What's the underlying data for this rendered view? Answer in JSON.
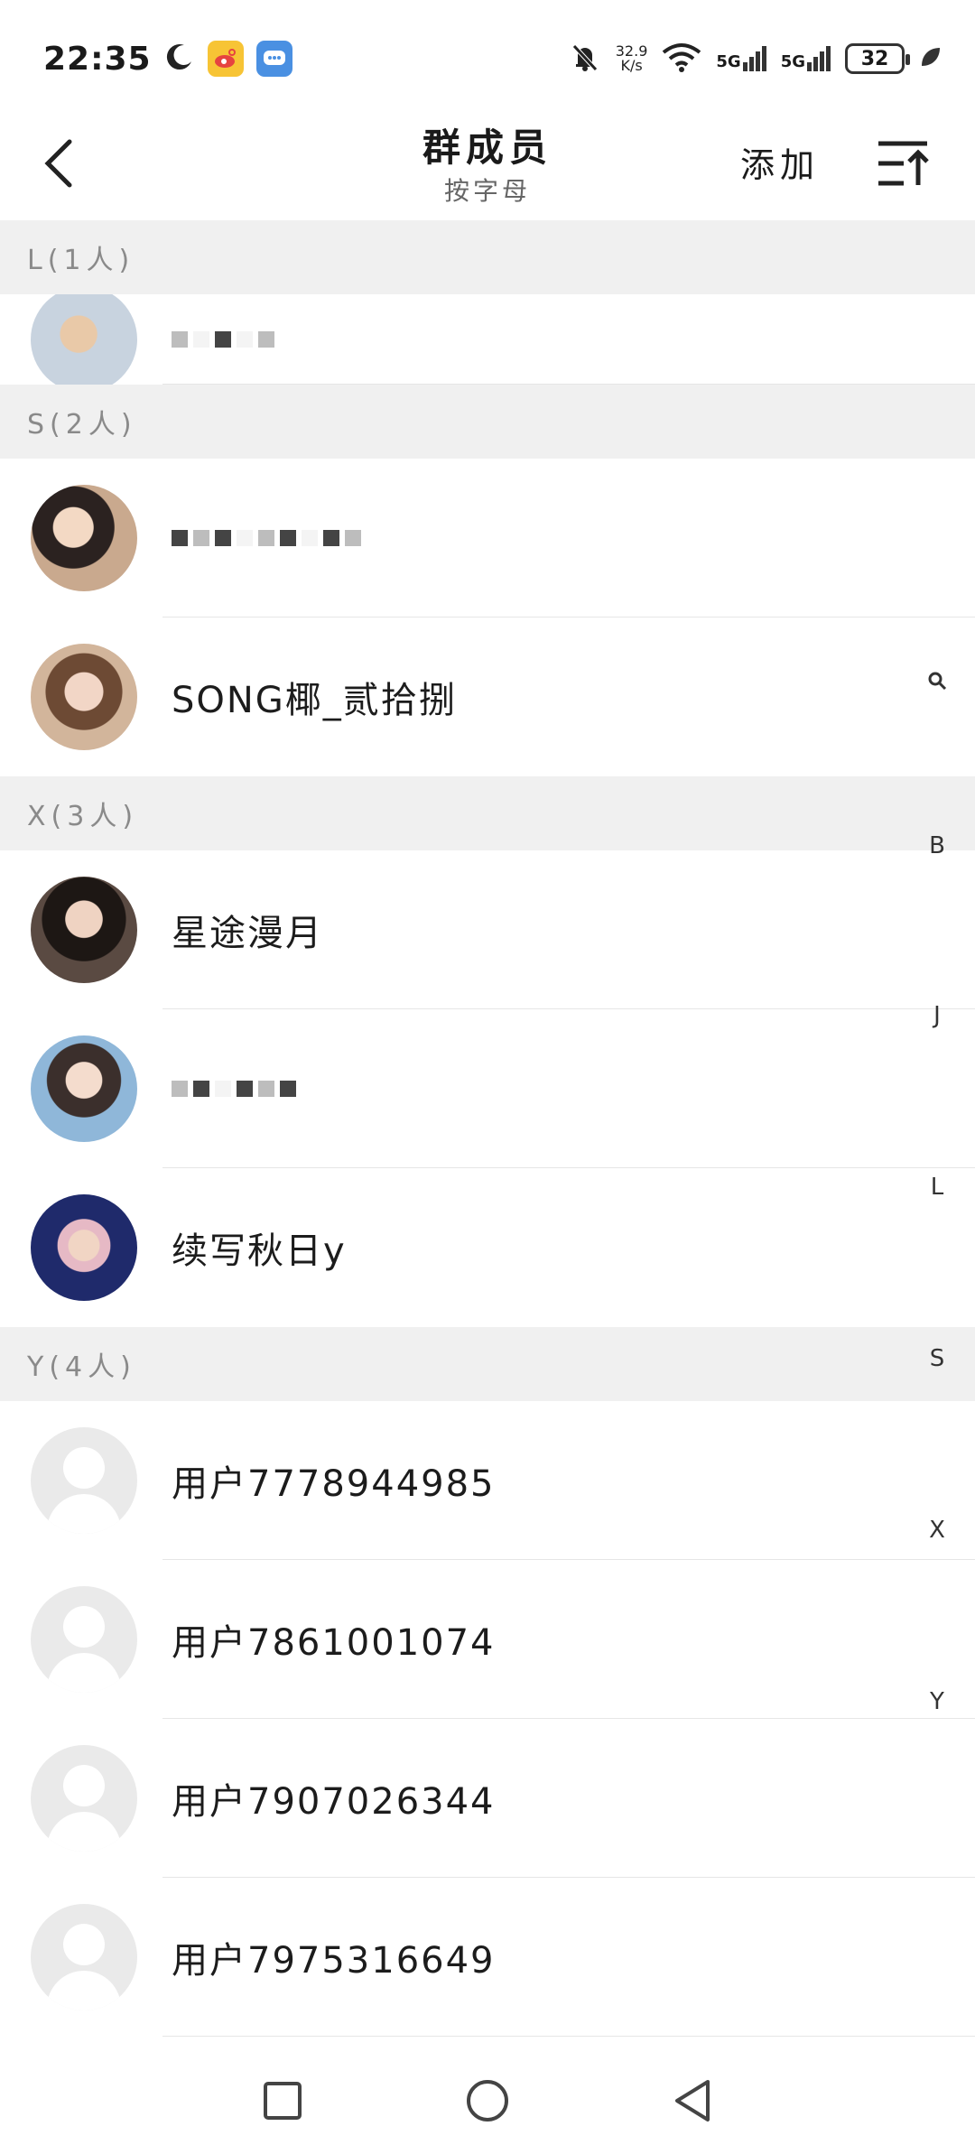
{
  "status_bar": {
    "time": "22:35",
    "net_speed_value": "32.9",
    "net_speed_unit": "K/s",
    "signal1_label": "5G",
    "signal2_label": "5G",
    "battery": "32"
  },
  "header": {
    "title": "群成员",
    "subtitle": "按字母",
    "add_label": "添加"
  },
  "sections": [
    {
      "header": "L(1人)",
      "members": [
        {
          "name": "",
          "masked": true
        }
      ]
    },
    {
      "header": "S(2人)",
      "members": [
        {
          "name": "",
          "masked": true
        },
        {
          "name": "SONG椰_贰拾捌",
          "masked": false
        }
      ]
    },
    {
      "header": "X(3人)",
      "members": [
        {
          "name": "星途漫月",
          "masked": false
        },
        {
          "name": "",
          "masked": true
        },
        {
          "name": "续写秋日y",
          "masked": false
        }
      ]
    },
    {
      "header": "Y(4人)",
      "members": [
        {
          "name": "用户7778944985",
          "masked": false
        },
        {
          "name": "用户7861001074",
          "masked": false
        },
        {
          "name": "用户7907026344",
          "masked": false
        },
        {
          "name": "用户7975316649",
          "masked": false
        }
      ]
    }
  ],
  "index_bar": [
    "B",
    "J",
    "L",
    "S",
    "X",
    "Y"
  ],
  "colors": {
    "section_bg": "#f0f0f0",
    "text_primary": "#1c1c1c",
    "text_secondary": "#8a8a8a"
  }
}
